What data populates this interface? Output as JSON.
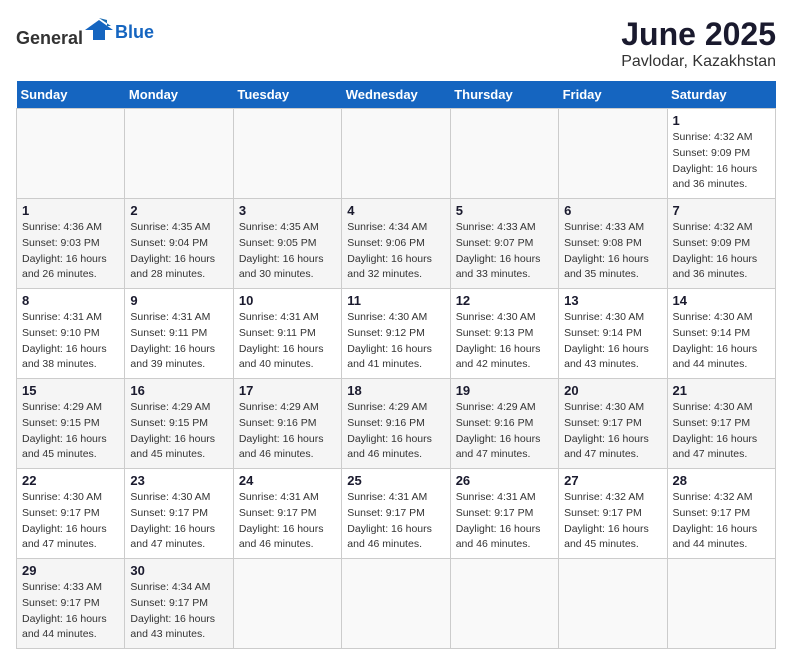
{
  "header": {
    "logo_general": "General",
    "logo_blue": "Blue",
    "month_title": "June 2025",
    "location": "Pavlodar, Kazakhstan"
  },
  "calendar": {
    "days_of_week": [
      "Sunday",
      "Monday",
      "Tuesday",
      "Wednesday",
      "Thursday",
      "Friday",
      "Saturday"
    ],
    "weeks": [
      [
        {
          "day": null
        },
        {
          "day": null
        },
        {
          "day": null
        },
        {
          "day": null
        },
        {
          "day": null
        },
        {
          "day": null
        },
        {
          "day": 1,
          "sunrise": "4:32 AM",
          "sunset": "9:09 PM",
          "daylight": "16 hours and 36 minutes."
        }
      ],
      [
        {
          "day": 1,
          "sunrise": "4:36 AM",
          "sunset": "9:03 PM",
          "daylight": "16 hours and 26 minutes."
        },
        {
          "day": 2,
          "sunrise": "4:35 AM",
          "sunset": "9:04 PM",
          "daylight": "16 hours and 28 minutes."
        },
        {
          "day": 3,
          "sunrise": "4:35 AM",
          "sunset": "9:05 PM",
          "daylight": "16 hours and 30 minutes."
        },
        {
          "day": 4,
          "sunrise": "4:34 AM",
          "sunset": "9:06 PM",
          "daylight": "16 hours and 32 minutes."
        },
        {
          "day": 5,
          "sunrise": "4:33 AM",
          "sunset": "9:07 PM",
          "daylight": "16 hours and 33 minutes."
        },
        {
          "day": 6,
          "sunrise": "4:33 AM",
          "sunset": "9:08 PM",
          "daylight": "16 hours and 35 minutes."
        },
        {
          "day": 7,
          "sunrise": "4:32 AM",
          "sunset": "9:09 PM",
          "daylight": "16 hours and 36 minutes."
        }
      ],
      [
        {
          "day": 8,
          "sunrise": "4:31 AM",
          "sunset": "9:10 PM",
          "daylight": "16 hours and 38 minutes."
        },
        {
          "day": 9,
          "sunrise": "4:31 AM",
          "sunset": "9:11 PM",
          "daylight": "16 hours and 39 minutes."
        },
        {
          "day": 10,
          "sunrise": "4:31 AM",
          "sunset": "9:11 PM",
          "daylight": "16 hours and 40 minutes."
        },
        {
          "day": 11,
          "sunrise": "4:30 AM",
          "sunset": "9:12 PM",
          "daylight": "16 hours and 41 minutes."
        },
        {
          "day": 12,
          "sunrise": "4:30 AM",
          "sunset": "9:13 PM",
          "daylight": "16 hours and 42 minutes."
        },
        {
          "day": 13,
          "sunrise": "4:30 AM",
          "sunset": "9:14 PM",
          "daylight": "16 hours and 43 minutes."
        },
        {
          "day": 14,
          "sunrise": "4:30 AM",
          "sunset": "9:14 PM",
          "daylight": "16 hours and 44 minutes."
        }
      ],
      [
        {
          "day": 15,
          "sunrise": "4:29 AM",
          "sunset": "9:15 PM",
          "daylight": "16 hours and 45 minutes."
        },
        {
          "day": 16,
          "sunrise": "4:29 AM",
          "sunset": "9:15 PM",
          "daylight": "16 hours and 45 minutes."
        },
        {
          "day": 17,
          "sunrise": "4:29 AM",
          "sunset": "9:16 PM",
          "daylight": "16 hours and 46 minutes."
        },
        {
          "day": 18,
          "sunrise": "4:29 AM",
          "sunset": "9:16 PM",
          "daylight": "16 hours and 46 minutes."
        },
        {
          "day": 19,
          "sunrise": "4:29 AM",
          "sunset": "9:16 PM",
          "daylight": "16 hours and 47 minutes."
        },
        {
          "day": 20,
          "sunrise": "4:30 AM",
          "sunset": "9:17 PM",
          "daylight": "16 hours and 47 minutes."
        },
        {
          "day": 21,
          "sunrise": "4:30 AM",
          "sunset": "9:17 PM",
          "daylight": "16 hours and 47 minutes."
        }
      ],
      [
        {
          "day": 22,
          "sunrise": "4:30 AM",
          "sunset": "9:17 PM",
          "daylight": "16 hours and 47 minutes."
        },
        {
          "day": 23,
          "sunrise": "4:30 AM",
          "sunset": "9:17 PM",
          "daylight": "16 hours and 47 minutes."
        },
        {
          "day": 24,
          "sunrise": "4:31 AM",
          "sunset": "9:17 PM",
          "daylight": "16 hours and 46 minutes."
        },
        {
          "day": 25,
          "sunrise": "4:31 AM",
          "sunset": "9:17 PM",
          "daylight": "16 hours and 46 minutes."
        },
        {
          "day": 26,
          "sunrise": "4:31 AM",
          "sunset": "9:17 PM",
          "daylight": "16 hours and 46 minutes."
        },
        {
          "day": 27,
          "sunrise": "4:32 AM",
          "sunset": "9:17 PM",
          "daylight": "16 hours and 45 minutes."
        },
        {
          "day": 28,
          "sunrise": "4:32 AM",
          "sunset": "9:17 PM",
          "daylight": "16 hours and 44 minutes."
        }
      ],
      [
        {
          "day": 29,
          "sunrise": "4:33 AM",
          "sunset": "9:17 PM",
          "daylight": "16 hours and 44 minutes."
        },
        {
          "day": 30,
          "sunrise": "4:34 AM",
          "sunset": "9:17 PM",
          "daylight": "16 hours and 43 minutes."
        },
        {
          "day": null
        },
        {
          "day": null
        },
        {
          "day": null
        },
        {
          "day": null
        },
        {
          "day": null
        }
      ]
    ]
  }
}
